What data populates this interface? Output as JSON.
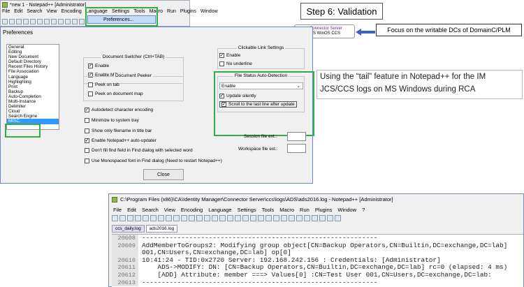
{
  "np1": {
    "title": "*new 1 - Notepad++ [Administrator]",
    "menu": [
      "File",
      "Edit",
      "Search",
      "View",
      "Encoding",
      "Language",
      "Settings",
      "Tools",
      "Macro",
      "Run",
      "Plugins",
      "Window"
    ],
    "preferences_item": "Preferences..."
  },
  "step_label": "Step 6: Validation",
  "badge": {
    "icon_text": "CS",
    "line1": "Connector Server",
    "line2": "MS WinOS CCS"
  },
  "focus_text": "Focus on the writable DCs of DomainC/PLM",
  "note_text": "Using the “tail” feature in Notepad++ for the IM JCS/CCS logs on MS Windows during RCA",
  "prefs": {
    "title": "Preferences",
    "categories": [
      "General",
      "Editing",
      "New Document",
      "Default Directory",
      "Recent Files History",
      "File Association",
      "Language",
      "Highlighting",
      "Print",
      "Backup",
      "Auto-Completion",
      "Multi-Instance",
      "Delimiter",
      "Cloud",
      "Search Engine",
      "MISC."
    ],
    "doc_switcher_title": "Document Switcher (Ctrl+TAB)",
    "doc_switcher_enable": "Enable",
    "doc_switcher_mru": "Enable MRU behaviour",
    "doc_peeker_title": "Document Peeker",
    "peek_tab": "Peek on tab",
    "peek_map": "Peek on document map",
    "clickable_title": "Clickable Link Settings",
    "clickable_enable": "Enable",
    "no_underline": "No underline",
    "fsad_title": "File Status Auto-Detection",
    "fsad_select": "Enable",
    "update_silently": "Update silently",
    "scroll_last": "Scroll to the last line after update",
    "autodetect": "Autodetect character encoding",
    "minimize_tray": "Minimize to system tray",
    "show_filename": "Show only filename in title bar",
    "auto_updater": "Enable Notepad++ auto-updater",
    "dont_fill": "Don't fill find field in Find dialog with selected word",
    "monospaced": "Use Monospaced font in Find dialog (Need to restart Notepad++)",
    "session_ext": "Session file ext.:",
    "workspace_ext": "Workspace file ext.:",
    "close": "Close"
  },
  "np2": {
    "title": "C:\\Program Files (x86)\\CA\\Identity Manager\\Connector Server\\ccs\\logs\\ADS\\ads2016.log - Notepad++ [Administrator]",
    "menu": [
      "File",
      "Edit",
      "Search",
      "View",
      "Encoding",
      "Language",
      "Settings",
      "Tools",
      "Macro",
      "Run",
      "Plugins",
      "Window",
      "?"
    ],
    "tabs": [
      "ccs_daily.log",
      "ads2016.log"
    ],
    "lines": [
      {
        "n": "20608",
        "t": "------------------------------------------------------------"
      },
      {
        "n": "20609",
        "t": "AddMemberToGroups2: Modifying group object[CN=Backup Operators,CN=Builtin,DC=exchange,DC=lab]"
      },
      {
        "n": "",
        "t": "001,CN=Users,CN=exchange,DC=lab] op[0]"
      },
      {
        "n": "20610",
        "t": "10:41:24 - TID:0x2720 Server: 192.168.242.156 : Credentials: [Administrator]"
      },
      {
        "n": "20611",
        "t": "    ADS->MODIFY: DN: [CN=Backup Operators,CN=Builtin,DC=exchange,DC=lab] rc=0 (elapsed: 4 ms)"
      },
      {
        "n": "20612",
        "t": "    [ADD] Attribute: member ===> Values[0] :CN=Test User 001,CN=Users,DC=exchange,DC=lab:"
      },
      {
        "n": "20613",
        "t": "------------------------------------------------------------"
      }
    ]
  }
}
